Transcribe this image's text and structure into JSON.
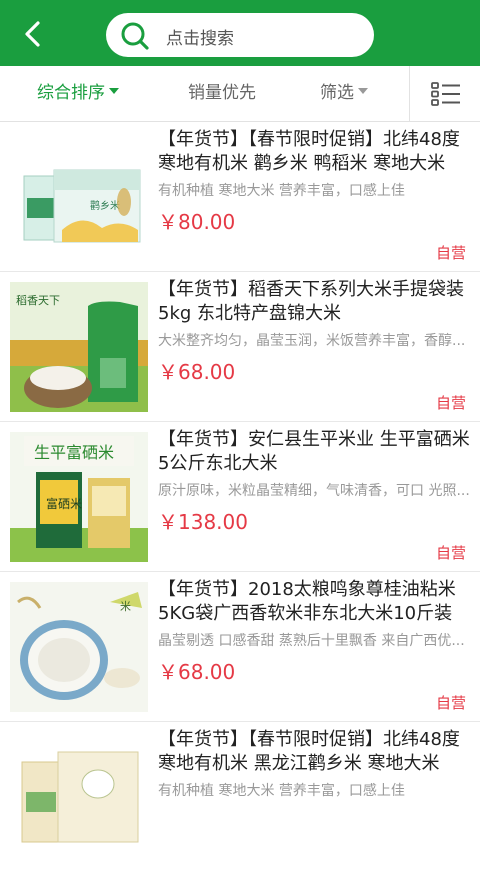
{
  "header": {
    "back_icon": "back-arrow-icon",
    "search_icon": "search-icon",
    "search_placeholder": "点击搜索",
    "bg_color": "#1a9e3f"
  },
  "filters": {
    "comprehensive": "综合排序",
    "sales": "销量优先",
    "filter": "筛选",
    "view_toggle_icon": "list-view-icon"
  },
  "colors": {
    "accent": "#1a9e3f",
    "price": "#e53945"
  },
  "products": [
    {
      "title": "【年货节】【春节限时促销】北纬48度寒地有机米 鹳乡米 鸭稻米 寒地大米",
      "desc": "有机种植 寒地大米 营养丰富，口感上佳",
      "price": "￥80.00",
      "tag": "自营"
    },
    {
      "title": "【年货节】稻香天下系列大米手提袋装5kg 东北特产盘锦大米",
      "desc": "大米整齐均匀，晶莹玉润，米饭营养丰富，香醇...",
      "price": "￥68.00",
      "tag": "自营"
    },
    {
      "title": "【年货节】安仁县生平米业 生平富硒米5公斤东北大米",
      "desc": "原汁原味，米粒晶莹精细，气味清香，可口 光照...",
      "price": "￥138.00",
      "tag": "自营"
    },
    {
      "title": "【年货节】2018太粮鸣象尊桂油粘米5KG袋广西香软米非东北大米10斤装",
      "desc": "晶莹剔透 口感香甜 蒸熟后十里飘香 来自广西优...",
      "price": "￥68.00",
      "tag": "自营"
    },
    {
      "title": "【年货节】【春节限时促销】北纬48度寒地有机米 黑龙江鹳乡米 寒地大米",
      "desc": "有机种植 寒地大米 营养丰富，口感上佳",
      "price": "",
      "tag": ""
    }
  ],
  "thumb_texts": {
    "p1_box": "鹳乡米",
    "p2_logo": "稻香天下",
    "p3_banner": "生平富硒米",
    "p3_bag": "富硒米",
    "p4_corner": "米"
  }
}
